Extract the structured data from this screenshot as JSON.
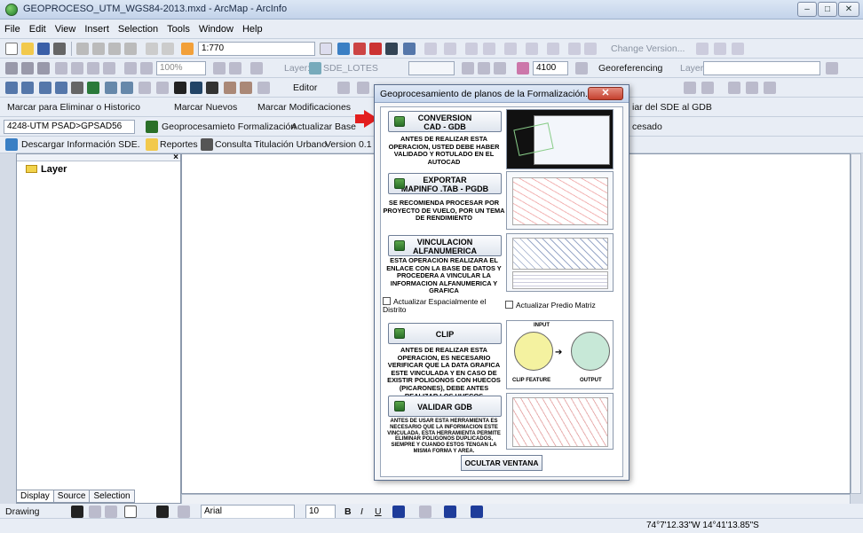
{
  "window": {
    "title": "GEOPROCESO_UTM_WGS84-2013.mxd - ArcMap - ArcInfo",
    "controls": [
      "–",
      "□",
      "✕"
    ]
  },
  "menu": [
    "File",
    "Edit",
    "View",
    "Insert",
    "Selection",
    "Tools",
    "Window",
    "Help"
  ],
  "toolbar1": {
    "scale_value": "1:770",
    "change_version_label": "Change Version..."
  },
  "toolbar2": {
    "zoom_value": "100%",
    "layer_label": "Layer:",
    "layer_value": "SDE_LOTES",
    "number_value": "4100",
    "georeferencing_label": "Georeferencing",
    "layer2_label": "Layer:"
  },
  "toolbar3": {
    "editor_label": "Editor"
  },
  "toolbar4": {
    "mark_delete_historic": "Marcar para Eliminar o Historico",
    "mark_new": "Marcar Nuevos",
    "mark_modifications": "Marcar Modificaciones",
    "copy_sde_gdb": "iar del SDE al GDB"
  },
  "toolbar5": {
    "projection_value": "4248-UTM PSAD>GPSAD56",
    "geoproc_formalization": "Geoprocesamieto Formalización",
    "update_base": "Actualizar Base",
    "processed": "cesado"
  },
  "toolbar6": {
    "download_sde": "Descargar Información SDE.",
    "reports": "Reportes",
    "urban_titling": "Consulta Titulación Urbano",
    "version": "Version 0.1"
  },
  "toc": {
    "root_layer": "Layer",
    "tabs": [
      "Display",
      "Source",
      "Selection"
    ]
  },
  "drawing_toolbar": {
    "drawing_label": "Drawing",
    "font_value": "Arial",
    "size_value": "10",
    "bold": "B",
    "italic": "I",
    "underline": "U"
  },
  "status": {
    "coordinates": "74°7'12.33\"W 14°41'13.85\"S"
  },
  "dialog": {
    "title": "Geoprocesamiento de planos de la Formalización.",
    "close": "✕",
    "sections": [
      {
        "button_line1": "CONVERSION",
        "button_line2": "CAD - GDB",
        "description": "ANTES DE REALIZAR ESTA OPERACION, USTED DEBE HABER VALIDADO Y ROTULADO EN EL AUTOCAD"
      },
      {
        "button_line1": "EXPORTAR",
        "button_line2": "MAPINFO .TAB - PGDB",
        "description": "SE RECOMIENDA PROCESAR POR PROYECTO DE VUELO, POR UN TEMA DE RENDIMIENTO"
      },
      {
        "button_line1": "VINCULACION",
        "button_line2": "ALFANUMERICA",
        "description": "ESTA OPERACION REALIZARA EL ENLACE CON LA BASE DE DATOS Y PROCEDERA A VINCULAR LA INFORMACION ALFANUMERICA Y GRAFICA"
      },
      {
        "button_line1": "CLIP",
        "button_line2": "",
        "description": "ANTES DE REALIZAR ESTA OPERACION, ES NECESARIO VERIFICAR QUE LA DATA GRAFICA ESTE VINCULADA Y EN CASO DE EXISTIR POLIGONOS CON HUECOS (PICARONES), DEBE ANTES REALIZAR LOS HUECOS MANUALMENTE (CLIP)."
      },
      {
        "button_line1": "VALIDAR GDB",
        "button_line2": "",
        "description": "ANTES DE USAR ESTA HERRAMIENTA ES NECESARIO QUE LA INFORMACION ESTE VINCULADA. ESTA HERRAMIENTA PERMITE ELIMINAR POLIGONOS DUPLICADOS, SIEMPRE Y CUANDO ESTOS TENGAN LA MISMA FORMA Y AREA."
      }
    ],
    "checkbox_update_spatial": "Actualizar Espacialmente el Distrito",
    "checkbox_update_parent": "Actualizar Predio Matriz",
    "clip_labels": {
      "input": "INPUT",
      "clip_feature": "CLIP FEATURE",
      "output": "OUTPUT"
    },
    "hide_button": "OCULTAR VENTANA"
  }
}
